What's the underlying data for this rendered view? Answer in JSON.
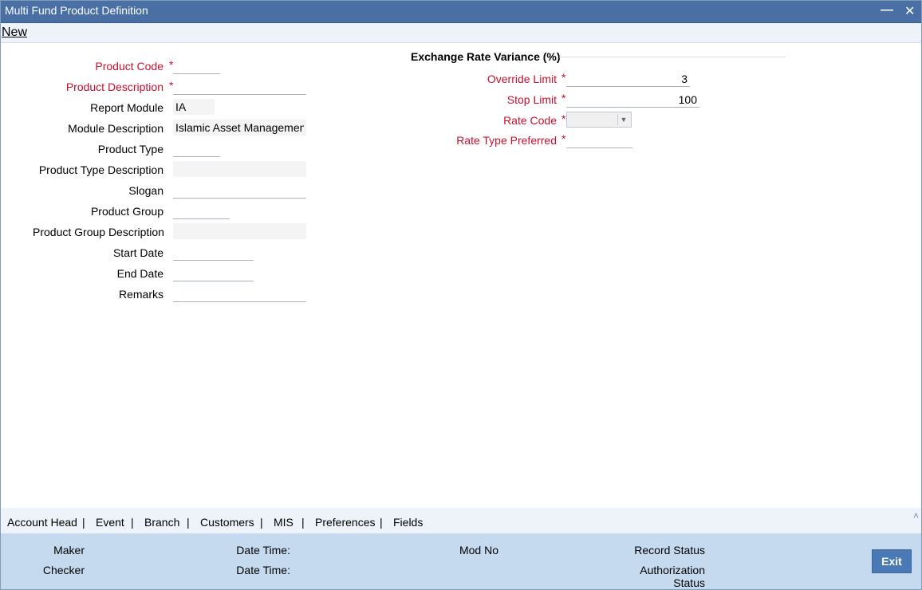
{
  "window": {
    "title": "Multi Fund Product Definition",
    "minimize_glyph": "—",
    "close_glyph": "✕"
  },
  "menu": {
    "new_label": "New"
  },
  "left_form": {
    "product_code_label": "Product Code",
    "product_code_value": "",
    "product_description_label": "Product Description",
    "product_description_value": "",
    "report_module_label": "Report Module",
    "report_module_value": "IA",
    "module_description_label": "Module Description",
    "module_description_value": "Islamic Asset Management",
    "product_type_label": "Product Type",
    "product_type_value": "",
    "product_type_description_label": "Product Type Description",
    "product_type_description_value": "",
    "slogan_label": "Slogan",
    "slogan_value": "",
    "product_group_label": "Product Group",
    "product_group_value": "",
    "product_group_description_label": "Product Group Description",
    "product_group_description_value": "",
    "start_date_label": "Start Date",
    "start_date_value": "",
    "end_date_label": "End Date",
    "end_date_value": "",
    "remarks_label": "Remarks",
    "remarks_value": ""
  },
  "exchange_rate": {
    "section_title": "Exchange Rate Variance (%)",
    "override_limit_label": "Override Limit",
    "override_limit_value": "3",
    "stop_limit_label": "Stop Limit",
    "stop_limit_value": "100",
    "rate_code_label": "Rate Code",
    "rate_code_value": "",
    "rate_type_preferred_label": "Rate Type Preferred",
    "rate_type_preferred_value": ""
  },
  "required_marker": "*",
  "tabs": {
    "items": [
      "Account Head",
      "Event",
      "Branch",
      "Customers",
      "MIS",
      "Preferences",
      "Fields"
    ],
    "separator": "|",
    "collapse_glyph": "˄"
  },
  "footer": {
    "maker_label": "Maker",
    "checker_label": "Checker",
    "date_time_label": "Date Time:",
    "mod_no_label": "Mod No",
    "record_status_label": "Record Status",
    "authorization_label": "Authorization",
    "status_label": "Status",
    "exit_label": "Exit"
  },
  "colors": {
    "title_bar": "#4a6fa5",
    "required": "#c8102e",
    "footer_bg": "#c5d9ef",
    "exit_button": "#4a7ab5"
  }
}
